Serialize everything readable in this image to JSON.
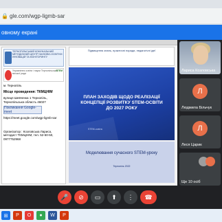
{
  "browser": {
    "url": "gle.com/wgp-ligmb-sar",
    "banner": "овному екрані"
  },
  "slide_left": {
    "logo1_text": "ТЕРНОПІЛЬСЬКИЙ КОМУНАЛЬНИЙ МЕТОДИЧНИЙ ЦЕНТР НАУКОВО-ОСВІТНІХ ІННОВАЦІЙ ТА МОНІТОРИНГУ",
    "logo2_text": "Управління освіти і науки Тернопільської міської ради",
    "logo2_right": "STEM",
    "city": "м. Тернопіль",
    "place_label": "Місце проведення: ТКМЦНІМ",
    "address": "вулиця Шевченка 1 Тернопіль, Тернопільська область 46027",
    "link": "Покликання Google-meet",
    "link_url": "https://meet.google.com/wgp-ligmb-sar",
    "organizer": "Організатор : Козловська Лариса, методист ТКМЦНІМ, тел. 52-50-50, 0977752968"
  },
  "slide_right": {
    "top_text": "Підвищення знань, практичні поради, педагогічні ідеї",
    "blue_title": "ПЛАН ЗАХОДІВ ЩОДО РЕАЛІЗАЦІЇ КОНЦЕПЦІЇ РОЗВИТКУ STEM-ОСВІТИ ДО 2027 РОКУ",
    "blue_sub": "STEM-освіта",
    "bottom_title": "Моделювання сучасного STEM-уроку",
    "bottom_sub": "Тернопіль 2022"
  },
  "participants": [
    {
      "name": "Лариса Козловська",
      "type": "photo"
    },
    {
      "name": "Людмила Більчук",
      "initial": "Л"
    },
    {
      "name": "Леся Царик",
      "initial": "Л"
    },
    {
      "name": "Ще 10 осіб",
      "type": "more"
    }
  ],
  "controls": [
    "mic-off",
    "camera-off",
    "captions",
    "present",
    "more",
    "end-call"
  ],
  "colors": {
    "end_call": "#ea4335",
    "avatar": "#e8704a",
    "banner": "#1a73e8"
  }
}
